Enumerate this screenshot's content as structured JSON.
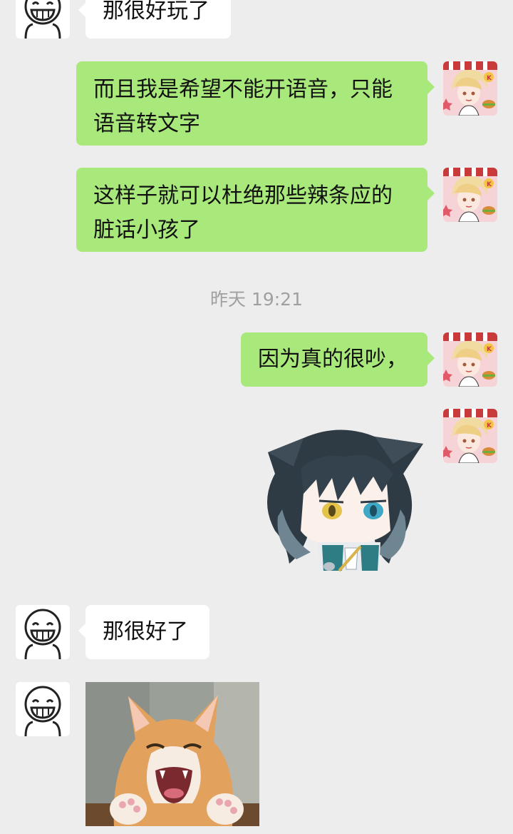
{
  "messages": {
    "m1": {
      "text": "那很好玩了"
    },
    "m2": {
      "text": "而且我是希望不能开语音，只能语音转文字"
    },
    "m3": {
      "text": "这样子就可以杜绝那些辣条应的脏话小孩了"
    },
    "timestamp": "昨天 19:21",
    "m4": {
      "text": "因为真的很吵，"
    },
    "m6": {
      "text": "那很好了"
    }
  },
  "icons": {
    "friend_avatar": "doodle-face-avatar",
    "self_avatar": "anime-blonde-boy-avatar",
    "sticker": "anime-cat-eared-chibi-sticker",
    "photo": "laughing-cat-image"
  },
  "colors": {
    "background": "#ededed",
    "outgoing_bubble": "#a9e97b",
    "incoming_bubble": "#ffffff",
    "timestamp_text": "#a0a0a0"
  }
}
